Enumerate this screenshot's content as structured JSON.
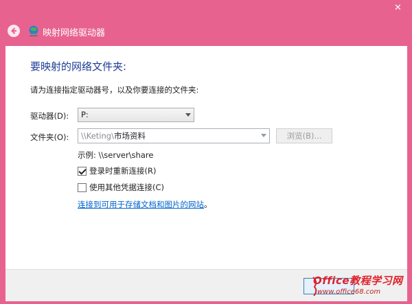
{
  "window": {
    "title": "映射网络驱动器",
    "close_glyph": "✕"
  },
  "main": {
    "heading": "要映射的网络文件夹:",
    "instruction": "请为连接指定驱动器号，以及你要连接的文件夹:",
    "drive_label": "驱动器(D):",
    "drive_value": "P:",
    "folder_label": "文件夹(O):",
    "folder_value_prefix": "\\\\Keting\\",
    "folder_value_suffix": "市场资料",
    "browse_label": "浏览(B)...",
    "example": "示例: \\\\server\\share",
    "reconnect_label": "登录时重新连接(R)",
    "reconnect_checked": true,
    "other_credentials_label": "使用其他凭据连接(C)",
    "other_credentials_checked": false,
    "link_text": "连接到可用于存储文档和图片的网站",
    "link_suffix": "。"
  },
  "watermark": {
    "brand": "Office教程学习网",
    "url": "www.office68.com"
  },
  "colors": {
    "frame": "#e8628f",
    "heading": "#1e3c96",
    "link": "#0066cc"
  }
}
